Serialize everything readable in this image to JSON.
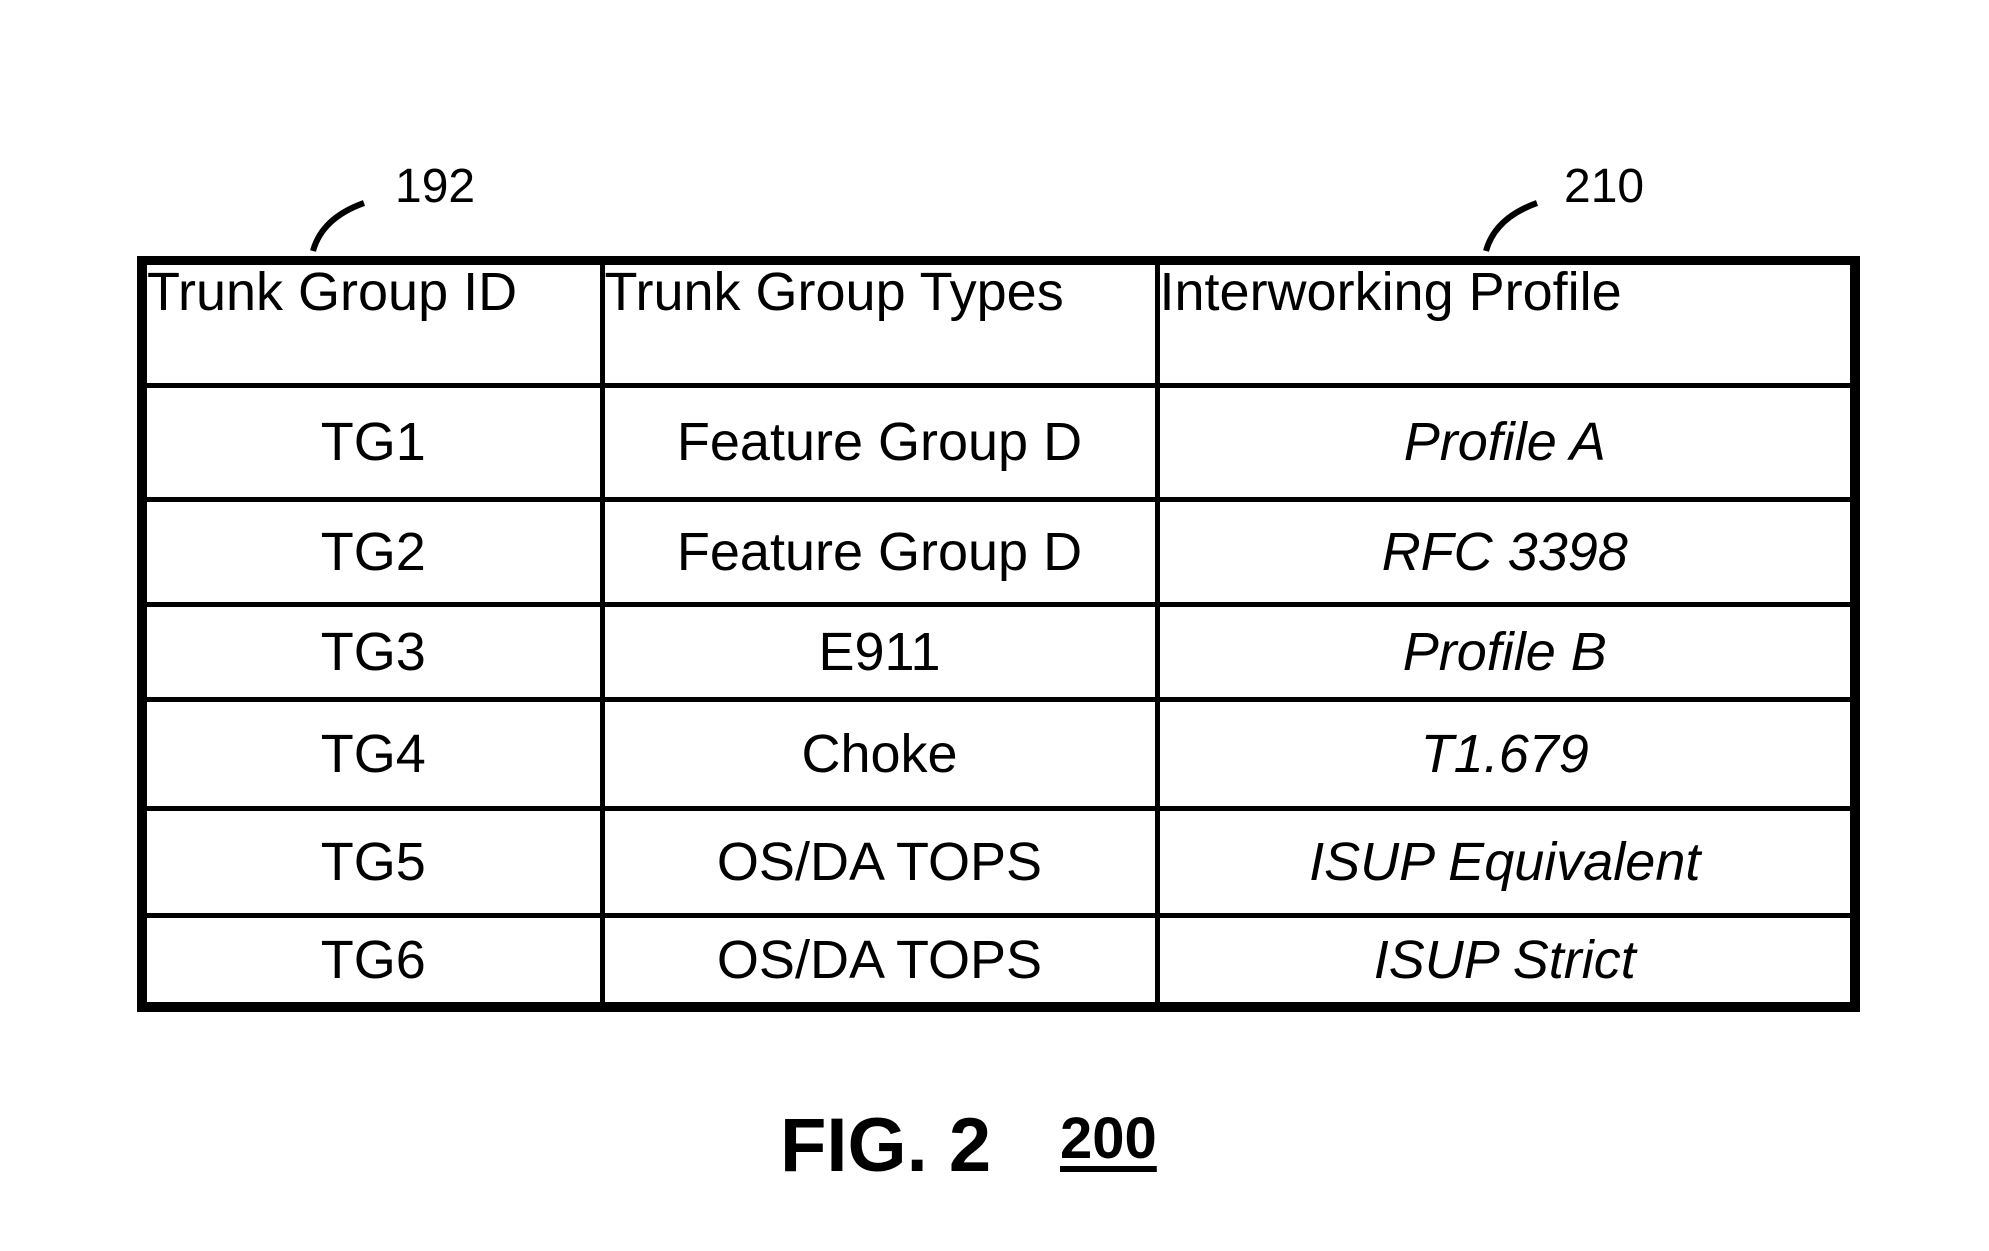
{
  "figure": {
    "caption": "FIG. 2",
    "reference_number": "200"
  },
  "callouts": [
    {
      "label": "192",
      "target": "trunk-group-id-column"
    },
    {
      "label": "210",
      "target": "interworking-profile-column"
    }
  ],
  "table": {
    "headers": [
      "Trunk Group ID",
      "Trunk Group Types",
      "Interworking Profile"
    ],
    "rows": [
      {
        "id": "TG1",
        "type": "Feature Group D",
        "profile": "Profile A"
      },
      {
        "id": "TG2",
        "type": "Feature Group D",
        "profile": "RFC 3398"
      },
      {
        "id": "TG3",
        "type": "E911",
        "profile": "Profile B"
      },
      {
        "id": "TG4",
        "type": "Choke",
        "profile": "T1.679"
      },
      {
        "id": "TG5",
        "type": "OS/DA TOPS",
        "profile": "ISUP Equivalent"
      },
      {
        "id": "TG6",
        "type": "OS/DA TOPS",
        "profile": "ISUP Strict"
      }
    ]
  },
  "colors": {
    "ink": "#000000",
    "background": "#ffffff"
  }
}
